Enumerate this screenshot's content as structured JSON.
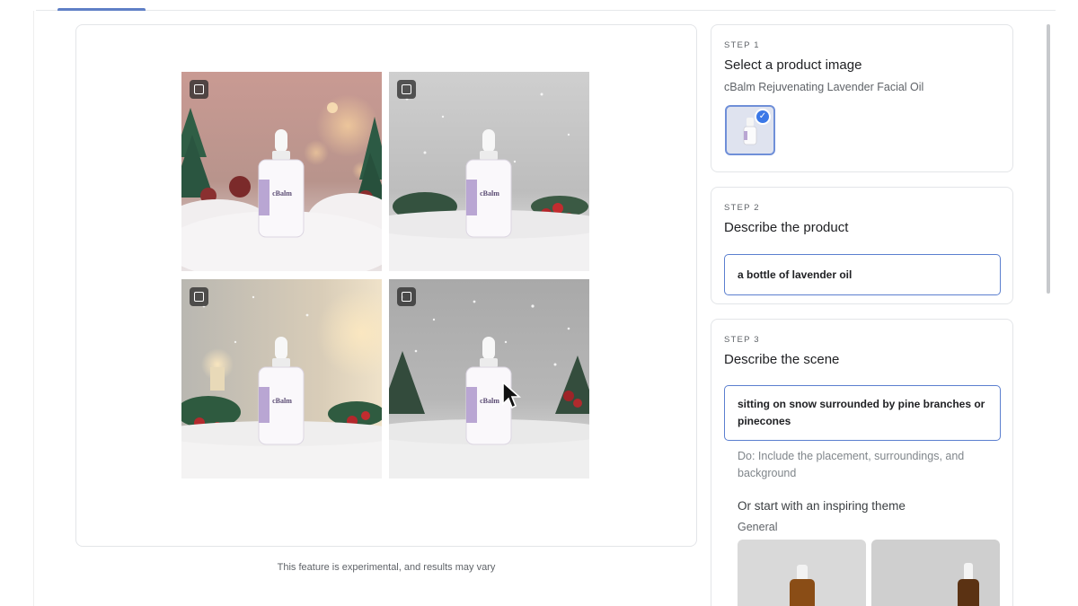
{
  "preview": {
    "tiles": [
      {
        "name": "result-image-1",
        "checkbox_checked": false
      },
      {
        "name": "result-image-2",
        "checkbox_checked": false
      },
      {
        "name": "result-image-3",
        "checkbox_checked": false
      },
      {
        "name": "result-image-4",
        "checkbox_checked": false
      }
    ],
    "bottle_brand": "cBalm",
    "disclaimer": "This feature is experimental, and results may vary"
  },
  "step1": {
    "label": "STEP 1",
    "title": "Select a product image",
    "product_name": "cBalm Rejuvenating Lavender Facial Oil"
  },
  "step2": {
    "label": "STEP 2",
    "title": "Describe the product",
    "value": "a bottle of lavender oil"
  },
  "step3": {
    "label": "STEP 3",
    "title": "Describe the scene",
    "value": "sitting on snow surrounded by pine branches or pinecones",
    "hint": "Do: Include the placement, surroundings, and background",
    "theme_title": "Or start with an inspiring theme",
    "theme_category": "General"
  },
  "colors": {
    "accent": "#5b7fcf",
    "selected_check": "#3b78e7"
  }
}
